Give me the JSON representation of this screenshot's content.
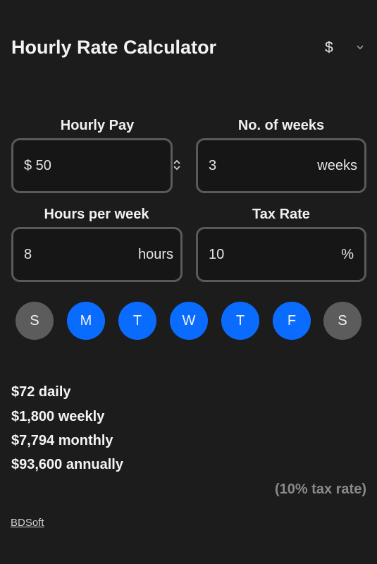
{
  "header": {
    "title": "Hourly Rate Calculator",
    "currency": "$"
  },
  "fields": {
    "hourly_pay": {
      "label": "Hourly Pay",
      "value": "$ 50"
    },
    "weeks": {
      "label": "No. of weeks",
      "value": "3",
      "unit": "weeks"
    },
    "hours": {
      "label": "Hours per week",
      "value": "8",
      "unit": "hours"
    },
    "tax": {
      "label": "Tax Rate",
      "value": "10",
      "unit": "%"
    }
  },
  "days": [
    {
      "label": "S",
      "selected": false
    },
    {
      "label": "M",
      "selected": true
    },
    {
      "label": "T",
      "selected": true
    },
    {
      "label": "W",
      "selected": true
    },
    {
      "label": "T",
      "selected": true
    },
    {
      "label": "F",
      "selected": true
    },
    {
      "label": "S",
      "selected": false
    }
  ],
  "results": {
    "daily": "$72 daily",
    "weekly": "$1,800 weekly",
    "monthly": "$7,794 monthly",
    "annually": "$93,600 annually",
    "tax_note": "(10% tax rate)"
  },
  "footer": {
    "brand": "BDSoft"
  },
  "colors": {
    "accent": "#0a6cff",
    "inactive_day": "#5c5c5c",
    "background": "#1c1c1d"
  }
}
